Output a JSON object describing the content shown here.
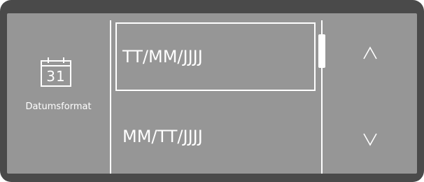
{
  "settings": {
    "label": "Datumsformat",
    "calendar_day": "31",
    "icon": "calendar-icon"
  },
  "options": [
    {
      "label": "TT/MM/JJJJ",
      "selected": true
    },
    {
      "label": "MM/TT/JJJJ",
      "selected": false
    }
  ],
  "scrollbar": {
    "position_fraction": 0.0
  },
  "navigation": {
    "up_icon": "chevron-up-icon",
    "down_icon": "chevron-down-icon"
  },
  "colors": {
    "screen_background": "#969696",
    "bezel": "#4a4a4a",
    "foreground": "#ffffff"
  }
}
